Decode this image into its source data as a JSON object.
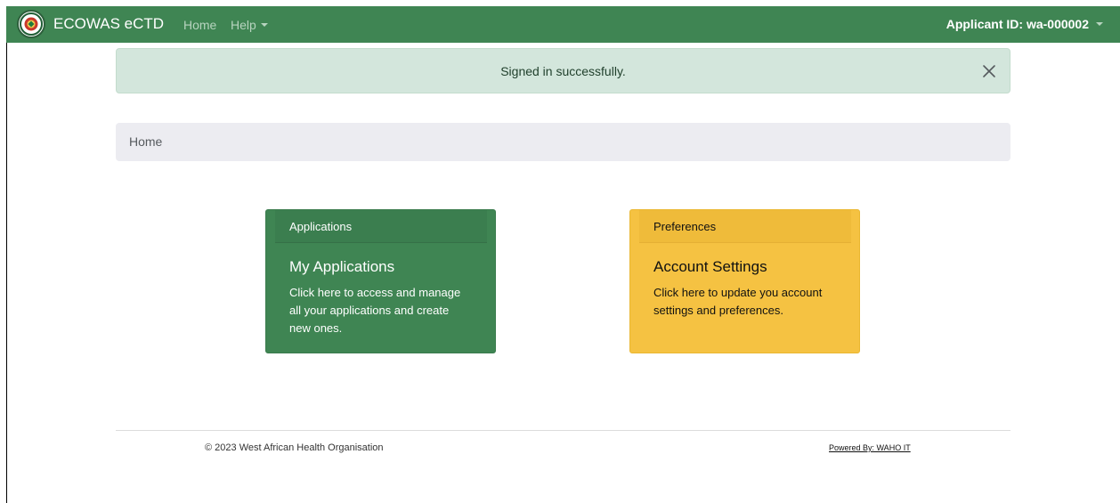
{
  "navbar": {
    "brand": "ECOWAS eCTD",
    "home_label": "Home",
    "help_label": "Help",
    "applicant_label": "Applicant ID: wa-000002",
    "background_color": "#3f8553"
  },
  "alert": {
    "message": "Signed in successfully.",
    "close_icon": "close-icon",
    "background_color": "#d3e6dc"
  },
  "breadcrumb": {
    "items": [
      "Home"
    ]
  },
  "cards": [
    {
      "header": "Applications",
      "title": "My Applications",
      "text": "Click here to access and manage all your applications and create new ones.",
      "color": "#3f8553"
    },
    {
      "header": "Preferences",
      "title": "Account Settings",
      "text": "Click here to update you account settings and preferences.",
      "color": "#f5c242"
    }
  ],
  "footer": {
    "copyright": "© 2023 West African Health Organisation",
    "powered_by": "Powered By: WAHO IT"
  }
}
